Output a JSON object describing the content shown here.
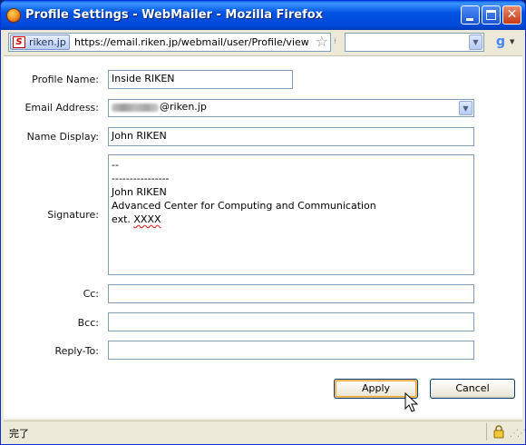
{
  "window": {
    "title": "Profile Settings - WebMailer - Mozilla Firefox"
  },
  "urlbar": {
    "site_identity": "riken.jp",
    "url": "https://email.riken.jp/webmail/user/Profile/view?&",
    "search_value": ""
  },
  "form": {
    "profile_name_label": "Profile Name:",
    "profile_name_value": "Inside RIKEN",
    "email_label": "Email Address:",
    "email_value_suffix": "@riken.jp",
    "name_display_label": "Name Display:",
    "name_display_value": "John RIKEN",
    "signature_label": "Signature:",
    "signature_lines": [
      "--",
      "----------------",
      "John RIKEN",
      "Advanced Center for Computing and Communication",
      "ext. ",
      "XXXX"
    ],
    "cc_label": "Cc:",
    "cc_value": "",
    "bcc_label": "Bcc:",
    "bcc_value": "",
    "reply_to_label": "Reply-To:",
    "reply_to_value": ""
  },
  "buttons": {
    "apply": "Apply",
    "cancel": "Cancel"
  },
  "status": {
    "text": "完了"
  }
}
